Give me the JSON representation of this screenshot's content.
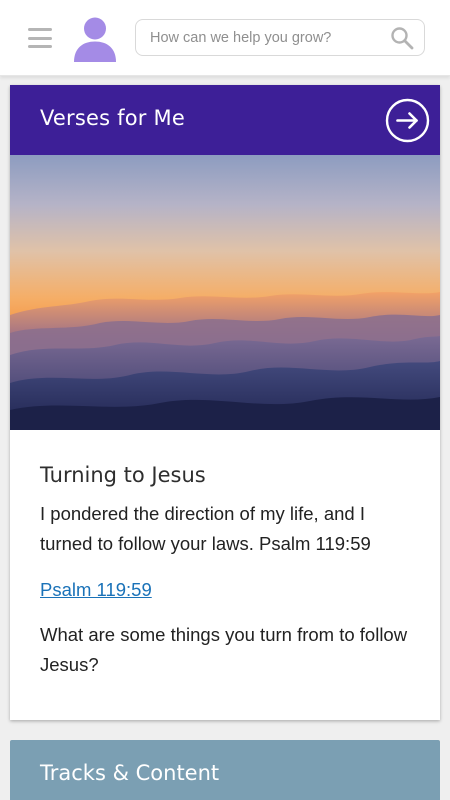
{
  "header": {
    "search_placeholder": "How can we help you grow?",
    "menu_icon": "hamburger-menu-icon",
    "avatar_icon": "user-avatar-icon",
    "search_icon": "search-icon"
  },
  "verse_card": {
    "title": "Verses for Me",
    "header_color": "#3d1f97",
    "arrow_icon": "arrow-right-circle-icon",
    "image_description_icon": "sunset-clouds-image",
    "heading": "Turning to Jesus",
    "text": "I pondered the direction of my life, and I turned to follow your laws. Psalm 119:59",
    "link_text": "Psalm 119:59",
    "question": "What are some things you turn from to follow Jesus?"
  },
  "tracks": {
    "title": "Tracks & Content",
    "color": "#7b9fb3"
  },
  "colors": {
    "accent": "#3d1f97",
    "avatar": "#a48be6",
    "link": "#1a72b8"
  }
}
